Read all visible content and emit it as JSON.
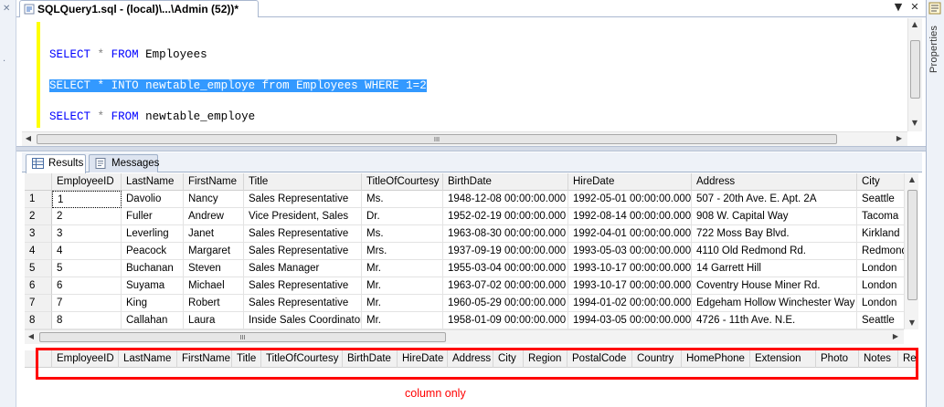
{
  "document": {
    "tab_title": "SQLQuery1.sql - (local)\\...\\Admin (52))*",
    "controls": {
      "dropdown": "▼",
      "close": "✕"
    }
  },
  "properties_panel": {
    "label": "Properties"
  },
  "editor": {
    "lines": [
      {
        "parts": [
          {
            "t": "SELECT",
            "c": "kw"
          },
          {
            "t": " ",
            "c": "id"
          },
          {
            "t": "*",
            "c": "op"
          },
          {
            "t": " ",
            "c": "id"
          },
          {
            "t": "FROM",
            "c": "kw"
          },
          {
            "t": " Employees",
            "c": "id"
          }
        ],
        "selected": false
      },
      {
        "parts": [
          {
            "t": "SELECT",
            "c": "kw"
          },
          {
            "t": " ",
            "c": "id"
          },
          {
            "t": "*",
            "c": "op"
          },
          {
            "t": " ",
            "c": "id"
          },
          {
            "t": "INTO",
            "c": "kw"
          },
          {
            "t": " newtable_employe ",
            "c": "id"
          },
          {
            "t": "from",
            "c": "kw"
          },
          {
            "t": " Employees ",
            "c": "id"
          },
          {
            "t": "WHERE",
            "c": "kw"
          },
          {
            "t": " 1",
            "c": "id"
          },
          {
            "t": "=",
            "c": "op"
          },
          {
            "t": "2",
            "c": "id"
          }
        ],
        "selected": true
      },
      {
        "parts": [
          {
            "t": "SELECT",
            "c": "kw"
          },
          {
            "t": " ",
            "c": "id"
          },
          {
            "t": "*",
            "c": "op"
          },
          {
            "t": " ",
            "c": "id"
          },
          {
            "t": "FROM",
            "c": "kw"
          },
          {
            "t": " newtable_employe",
            "c": "id"
          }
        ],
        "selected": false
      }
    ],
    "scroll_glyph": "III"
  },
  "results_tabs": [
    {
      "label": "Results",
      "active": true
    },
    {
      "label": "Messages",
      "active": false
    }
  ],
  "result_grid_1": {
    "columns": [
      "EmployeeID",
      "LastName",
      "FirstName",
      "Title",
      "TitleOfCourtesy",
      "BirthDate",
      "HireDate",
      "Address",
      "City"
    ],
    "rows": [
      [
        "1",
        "1",
        "Davolio",
        "Nancy",
        "Sales Representative",
        "Ms.",
        "1948-12-08 00:00:00.000",
        "1992-05-01 00:00:00.000",
        "507 - 20th Ave. E.  Apt. 2A",
        "Seattle"
      ],
      [
        "2",
        "2",
        "Fuller",
        "Andrew",
        "Vice President, Sales",
        "Dr.",
        "1952-02-19 00:00:00.000",
        "1992-08-14 00:00:00.000",
        "908 W. Capital Way",
        "Tacoma"
      ],
      [
        "3",
        "3",
        "Leverling",
        "Janet",
        "Sales Representative",
        "Ms.",
        "1963-08-30 00:00:00.000",
        "1992-04-01 00:00:00.000",
        "722 Moss Bay Blvd.",
        "Kirkland"
      ],
      [
        "4",
        "4",
        "Peacock",
        "Margaret",
        "Sales Representative",
        "Mrs.",
        "1937-09-19 00:00:00.000",
        "1993-05-03 00:00:00.000",
        "4110 Old Redmond Rd.",
        "Redmond"
      ],
      [
        "5",
        "5",
        "Buchanan",
        "Steven",
        "Sales Manager",
        "Mr.",
        "1955-03-04 00:00:00.000",
        "1993-10-17 00:00:00.000",
        "14 Garrett Hill",
        "London"
      ],
      [
        "6",
        "6",
        "Suyama",
        "Michael",
        "Sales Representative",
        "Mr.",
        "1963-07-02 00:00:00.000",
        "1993-10-17 00:00:00.000",
        "Coventry House  Miner Rd.",
        "London"
      ],
      [
        "7",
        "7",
        "King",
        "Robert",
        "Sales Representative",
        "Mr.",
        "1960-05-29 00:00:00.000",
        "1994-01-02 00:00:00.000",
        "Edgeham Hollow  Winchester Way",
        "London"
      ],
      [
        "8",
        "8",
        "Callahan",
        "Laura",
        "Inside Sales Coordinator",
        "Mr.",
        "1958-01-09 00:00:00.000",
        "1994-03-05 00:00:00.000",
        "4726 - 11th Ave. N.E.",
        "Seattle"
      ]
    ]
  },
  "result_grid_2": {
    "columns": [
      "EmployeeID",
      "LastName",
      "FirstName",
      "Title",
      "TitleOfCourtesy",
      "BirthDate",
      "HireDate",
      "Address",
      "City",
      "Region",
      "PostalCode",
      "Country",
      "HomePhone",
      "Extension",
      "Photo",
      "Notes",
      "Repo"
    ]
  },
  "scroll": {
    "up": "▲",
    "down": "▼",
    "left": "◀",
    "right": "▶",
    "grip": "III"
  },
  "annotation": {
    "text": "column only",
    "color": "#ff0000"
  },
  "colors": {
    "selection": "#3399ff",
    "keyword": "#0000ff",
    "margin": "#ffff00"
  }
}
